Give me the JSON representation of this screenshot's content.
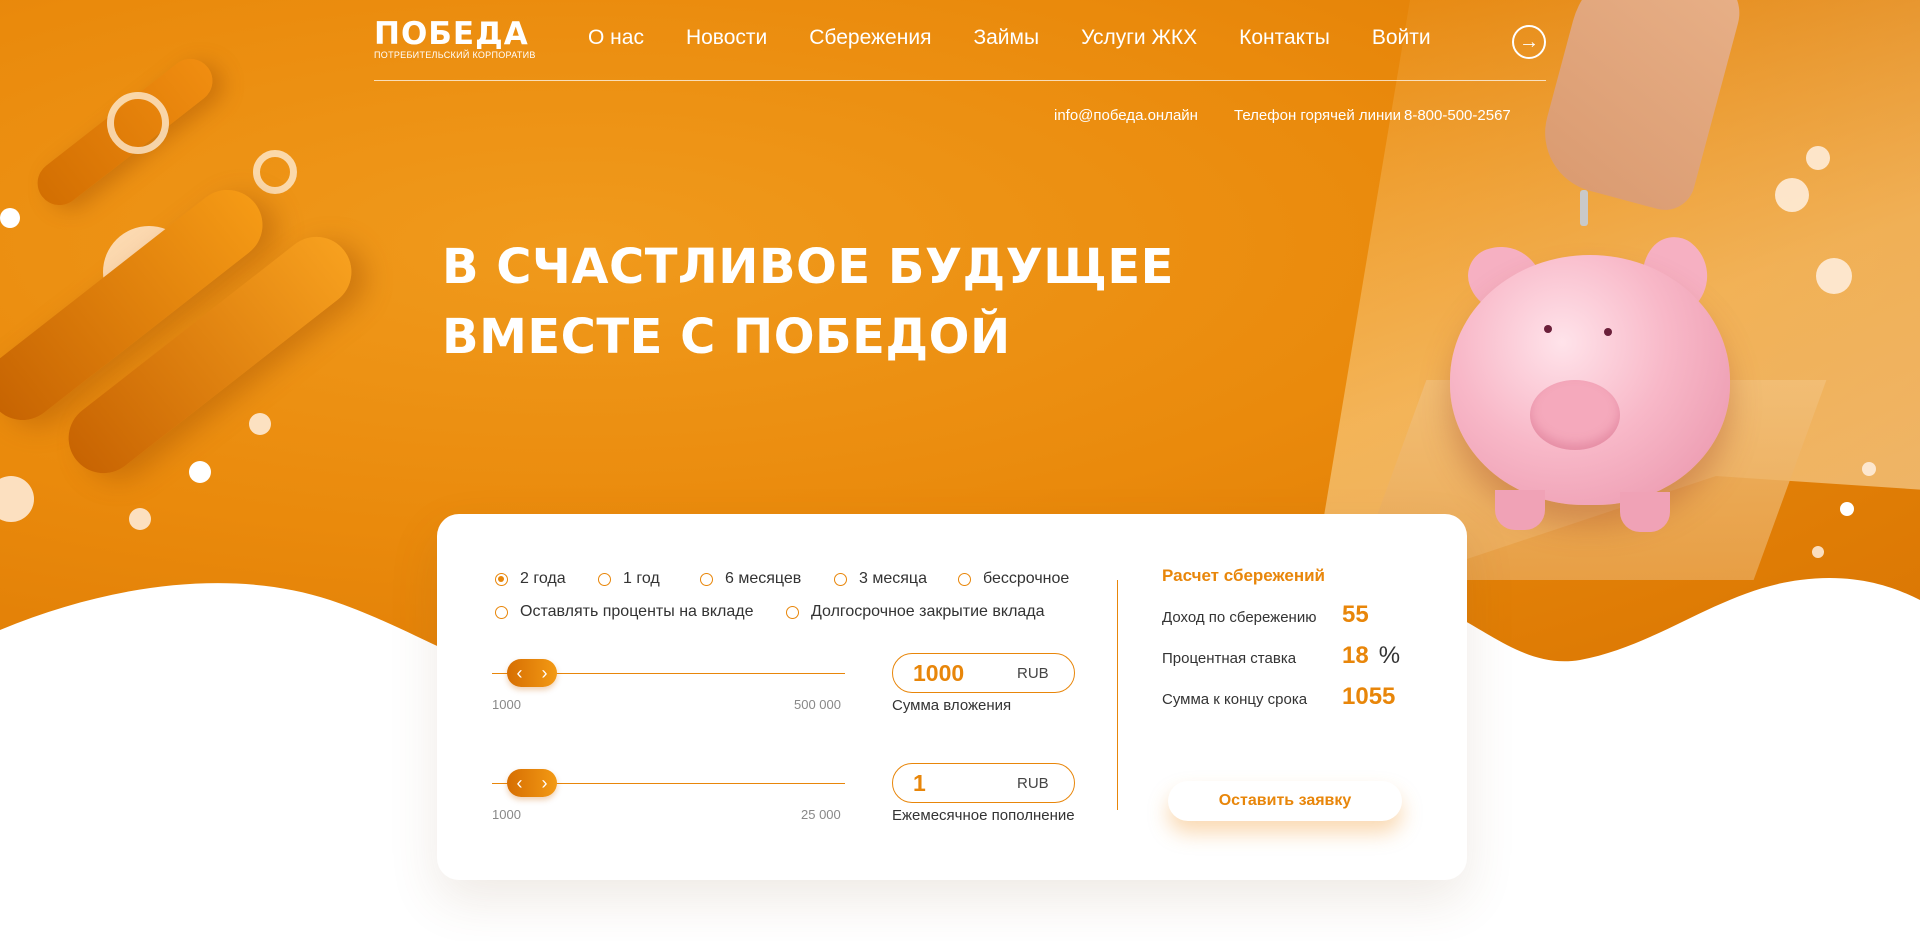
{
  "logo": {
    "title": "ПОБЕДА",
    "subtitle": "ПОТРЕБИТЕЛЬСКИЙ КОРПОРАТИВ"
  },
  "nav": {
    "items": [
      "О нас",
      "Новости",
      "Сбережения",
      "Займы",
      "Услуги ЖКХ",
      "Контакты"
    ],
    "login_label": "Войти",
    "login_icon": "arrow-right-circle-icon"
  },
  "contacts": {
    "email": "info@победа.онлайн",
    "hotline_label": "Телефон горячей линии",
    "phone": "8-800-500-2567"
  },
  "hero": {
    "line1": "В СЧАСТЛИВОЕ БУДУЩЕЕ",
    "line2": "ВМЕСТЕ С ПОБЕДОЙ"
  },
  "calculator": {
    "terms": [
      {
        "label": "2 года",
        "checked": true
      },
      {
        "label": "1 год",
        "checked": false
      },
      {
        "label": "6 месяцев",
        "checked": false
      },
      {
        "label": "3 месяца",
        "checked": false
      },
      {
        "label": "бессрочное",
        "checked": false
      }
    ],
    "options": [
      {
        "label": "Оставлять проценты на вкладе",
        "checked": false
      },
      {
        "label": "Долгосрочное закрытие вклада",
        "checked": false
      }
    ],
    "investment": {
      "min": "1000",
      "max": "500 000",
      "value": "1000",
      "currency": "RUB",
      "caption": "Сумма вложения",
      "level": 0
    },
    "monthly": {
      "min": "1000",
      "max": "25 000",
      "value": "1",
      "currency": "RUB",
      "caption": "Ежемесячное пополнение",
      "level": 0
    },
    "result": {
      "title": "Расчет сбережений",
      "income_label": "Доход по сбережению",
      "income_value": "55",
      "rate_label": "Процентная ставка",
      "rate_value": "18",
      "rate_unit": "%",
      "total_label": "Сумма к концу срока",
      "total_value": "1055"
    },
    "submit_label": "Оставить заявку"
  },
  "colors": {
    "accent": "#e8860a",
    "hero_orange": "#ea8a0c",
    "white": "#ffffff"
  }
}
